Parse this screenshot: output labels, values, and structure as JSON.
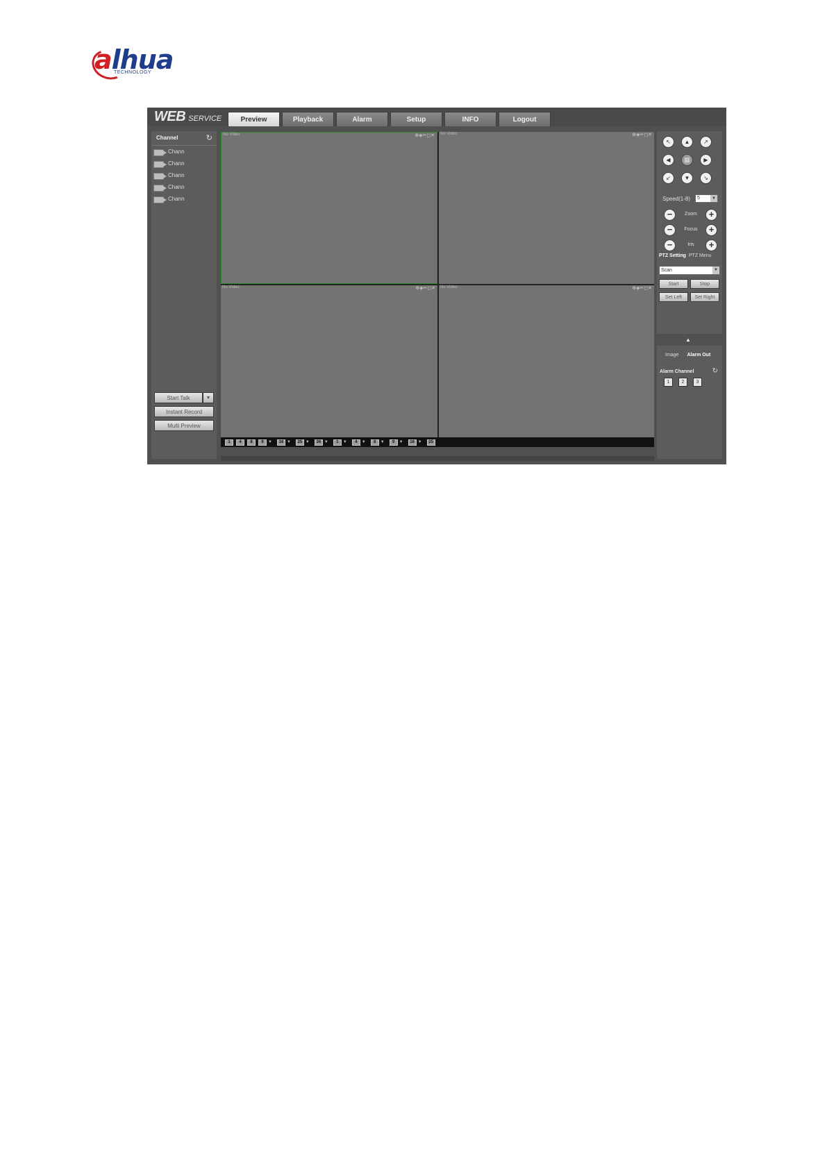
{
  "logo": {
    "word_a": "a",
    "word_rest": "lhua",
    "sub": "TECHNOLOGY"
  },
  "header": {
    "brand_web": "WEB",
    "brand_service": "SERVICE"
  },
  "tabs": [
    {
      "label": "Preview",
      "active": true
    },
    {
      "label": "Playback"
    },
    {
      "label": "Alarm"
    },
    {
      "label": "Setup"
    },
    {
      "label": "INFO"
    },
    {
      "label": "Logout"
    }
  ],
  "left_panel": {
    "channel_title": "Channel",
    "refresh_icon": "refresh-icon",
    "channels": [
      "Chann",
      "Chann",
      "Chann",
      "Chann",
      "Chann"
    ],
    "start_talk": "Start Talk",
    "instant_record": "Instant Record",
    "multi_preview": "Multi Preview"
  },
  "video": {
    "cells": [
      {
        "title": "No Video",
        "selected": true
      },
      {
        "title": "No Video"
      },
      {
        "title": "No Video"
      },
      {
        "title": "No Video"
      }
    ],
    "cell_icons": "⊕◈✂◻✕",
    "toolbar_icons": [
      "1",
      "4",
      "8",
      "9",
      "16",
      "25",
      "36",
      "1",
      "4",
      "8",
      "9",
      "16",
      "25",
      "36"
    ]
  },
  "ptz": {
    "directions": [
      "↖",
      "▲",
      "↗",
      "◀",
      "▦",
      "▶",
      "↙",
      "▼",
      "↘"
    ],
    "speed_label": "Speed(1-8)",
    "speed_value": "5",
    "zoom_label": "Zoom",
    "focus_label": "Focus",
    "iris_label": "Iris",
    "tab_setting": "PTZ Setting",
    "tab_menu": "PTZ Menu",
    "scan_value": "Scan",
    "start": "Start",
    "stop": "Stop",
    "set_left": "Set Left",
    "set_right": "Set Right"
  },
  "alarm_panel": {
    "tab_image": "Image",
    "tab_alarm_out": "Alarm Out",
    "alarm_channel_label": "Alarm Channel",
    "channels": [
      "1",
      "2",
      "3"
    ]
  },
  "colors": {
    "brand_red": "#d21f26",
    "brand_blue": "#1f3d8a",
    "window_bg": "#505050",
    "video_bg": "#737373",
    "selected_border": "#2f8a2f"
  }
}
